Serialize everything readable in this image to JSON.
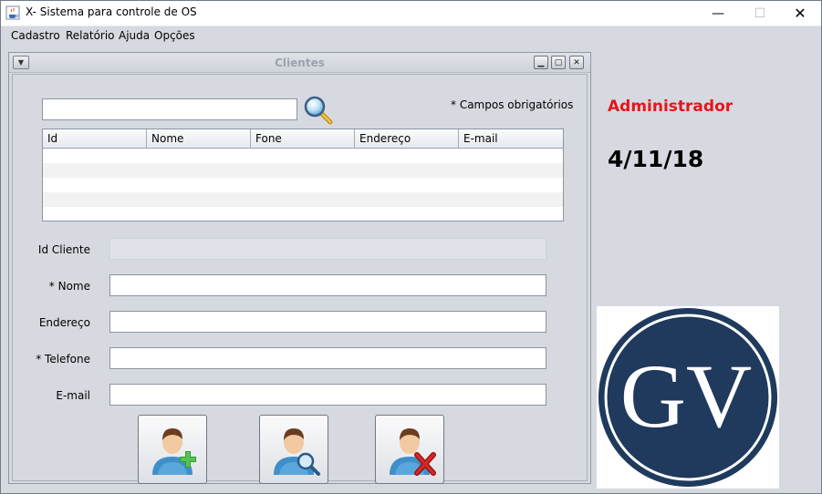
{
  "window": {
    "title": "X- Sistema para controle de OS"
  },
  "menu": {
    "items": [
      "Cadastro",
      "Relatório",
      "Ajuda",
      "Opções"
    ]
  },
  "frame": {
    "title": "Clientes"
  },
  "search": {
    "value": "",
    "icon": "search-icon"
  },
  "required_note": "* Campos obrigatórios",
  "table": {
    "columns": [
      "Id",
      "Nome",
      "Fone",
      "Endereço",
      "E-mail"
    ],
    "rows": []
  },
  "form": {
    "id_label": "Id Cliente",
    "name_label": "* Nome",
    "address_label": "Endereço",
    "phone_label": "* Telefone",
    "email_label": "E-mail",
    "id_value": "",
    "name_value": "",
    "address_value": "",
    "phone_value": "",
    "email_value": ""
  },
  "actions": {
    "icons": [
      "user-add-icon",
      "user-search-icon",
      "user-delete-icon"
    ]
  },
  "user": "Administrador",
  "date": "4/11/18",
  "logo": {
    "text": "GV",
    "color": "#1f3a5c"
  },
  "colors": {
    "user_label": "#e8141b",
    "table_stripe": "#f2f2f2"
  }
}
